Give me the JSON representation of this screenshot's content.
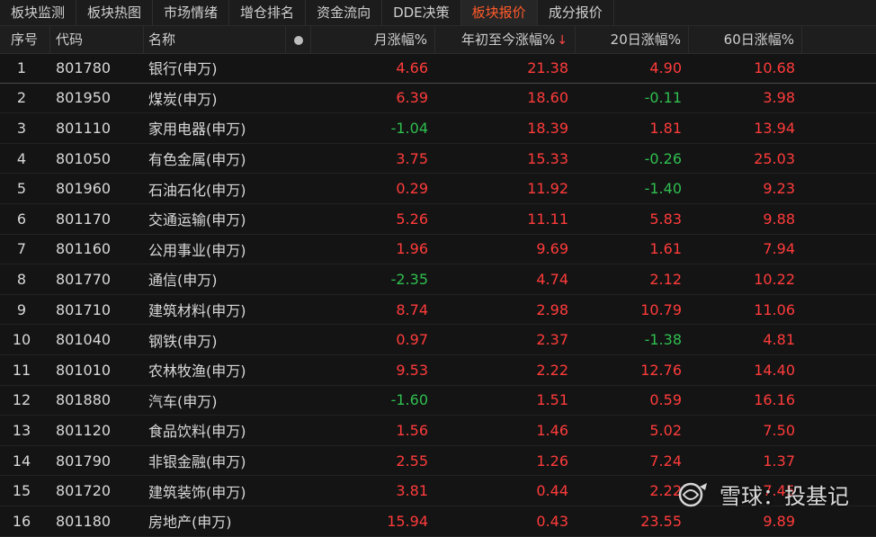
{
  "tabs": [
    {
      "label": "板块监测",
      "active": false
    },
    {
      "label": "板块热图",
      "active": false
    },
    {
      "label": "市场情绪",
      "active": false
    },
    {
      "label": "增仓排名",
      "active": false
    },
    {
      "label": "资金流向",
      "active": false
    },
    {
      "label": "DDE决策",
      "active": false
    },
    {
      "label": "板块报价",
      "active": true
    },
    {
      "label": "成分报价",
      "active": false
    }
  ],
  "table": {
    "headers": {
      "idx": "序号",
      "code": "代码",
      "name": "名称",
      "month": "月涨幅%",
      "ytd": "年初至今涨幅%",
      "d20": "20日涨幅%",
      "d60": "60日涨幅%"
    },
    "sort_arrow": "↓",
    "rows": [
      {
        "idx": "1",
        "code": "801780",
        "name": "银行(申万)",
        "month": "4.66",
        "ytd": "21.38",
        "d20": "4.90",
        "d60": "10.68"
      },
      {
        "idx": "2",
        "code": "801950",
        "name": "煤炭(申万)",
        "month": "6.39",
        "ytd": "18.60",
        "d20": "-0.11",
        "d60": "3.98"
      },
      {
        "idx": "3",
        "code": "801110",
        "name": "家用电器(申万)",
        "month": "-1.04",
        "ytd": "18.39",
        "d20": "1.81",
        "d60": "13.94"
      },
      {
        "idx": "4",
        "code": "801050",
        "name": "有色金属(申万)",
        "month": "3.75",
        "ytd": "15.33",
        "d20": "-0.26",
        "d60": "25.03"
      },
      {
        "idx": "5",
        "code": "801960",
        "name": "石油石化(申万)",
        "month": "0.29",
        "ytd": "11.92",
        "d20": "-1.40",
        "d60": "9.23"
      },
      {
        "idx": "6",
        "code": "801170",
        "name": "交通运输(申万)",
        "month": "5.26",
        "ytd": "11.11",
        "d20": "5.83",
        "d60": "9.88"
      },
      {
        "idx": "7",
        "code": "801160",
        "name": "公用事业(申万)",
        "month": "1.96",
        "ytd": "9.69",
        "d20": "1.61",
        "d60": "7.94"
      },
      {
        "idx": "8",
        "code": "801770",
        "name": "通信(申万)",
        "month": "-2.35",
        "ytd": "4.74",
        "d20": "2.12",
        "d60": "10.22"
      },
      {
        "idx": "9",
        "code": "801710",
        "name": "建筑材料(申万)",
        "month": "8.74",
        "ytd": "2.98",
        "d20": "10.79",
        "d60": "11.06"
      },
      {
        "idx": "10",
        "code": "801040",
        "name": "钢铁(申万)",
        "month": "0.97",
        "ytd": "2.37",
        "d20": "-1.38",
        "d60": "4.81"
      },
      {
        "idx": "11",
        "code": "801010",
        "name": "农林牧渔(申万)",
        "month": "9.53",
        "ytd": "2.22",
        "d20": "12.76",
        "d60": "14.40"
      },
      {
        "idx": "12",
        "code": "801880",
        "name": "汽车(申万)",
        "month": "-1.60",
        "ytd": "1.51",
        "d20": "0.59",
        "d60": "16.16"
      },
      {
        "idx": "13",
        "code": "801120",
        "name": "食品饮料(申万)",
        "month": "1.56",
        "ytd": "1.46",
        "d20": "5.02",
        "d60": "7.50"
      },
      {
        "idx": "14",
        "code": "801790",
        "name": "非银金融(申万)",
        "month": "2.55",
        "ytd": "1.26",
        "d20": "7.24",
        "d60": "1.37"
      },
      {
        "idx": "15",
        "code": "801720",
        "name": "建筑装饰(申万)",
        "month": "3.81",
        "ytd": "0.44",
        "d20": "2.22",
        "d60": "7.45"
      },
      {
        "idx": "16",
        "code": "801180",
        "name": "房地产(申万)",
        "month": "15.94",
        "ytd": "0.43",
        "d20": "23.55",
        "d60": "9.89"
      }
    ]
  },
  "watermark": {
    "text": "雪球：投基记",
    "icon": "snowball-logo-icon"
  },
  "colors": {
    "up": "#ff3b3b",
    "down": "#2fbf4f",
    "active_tab": "#ff5a2a",
    "background": "#141414"
  }
}
